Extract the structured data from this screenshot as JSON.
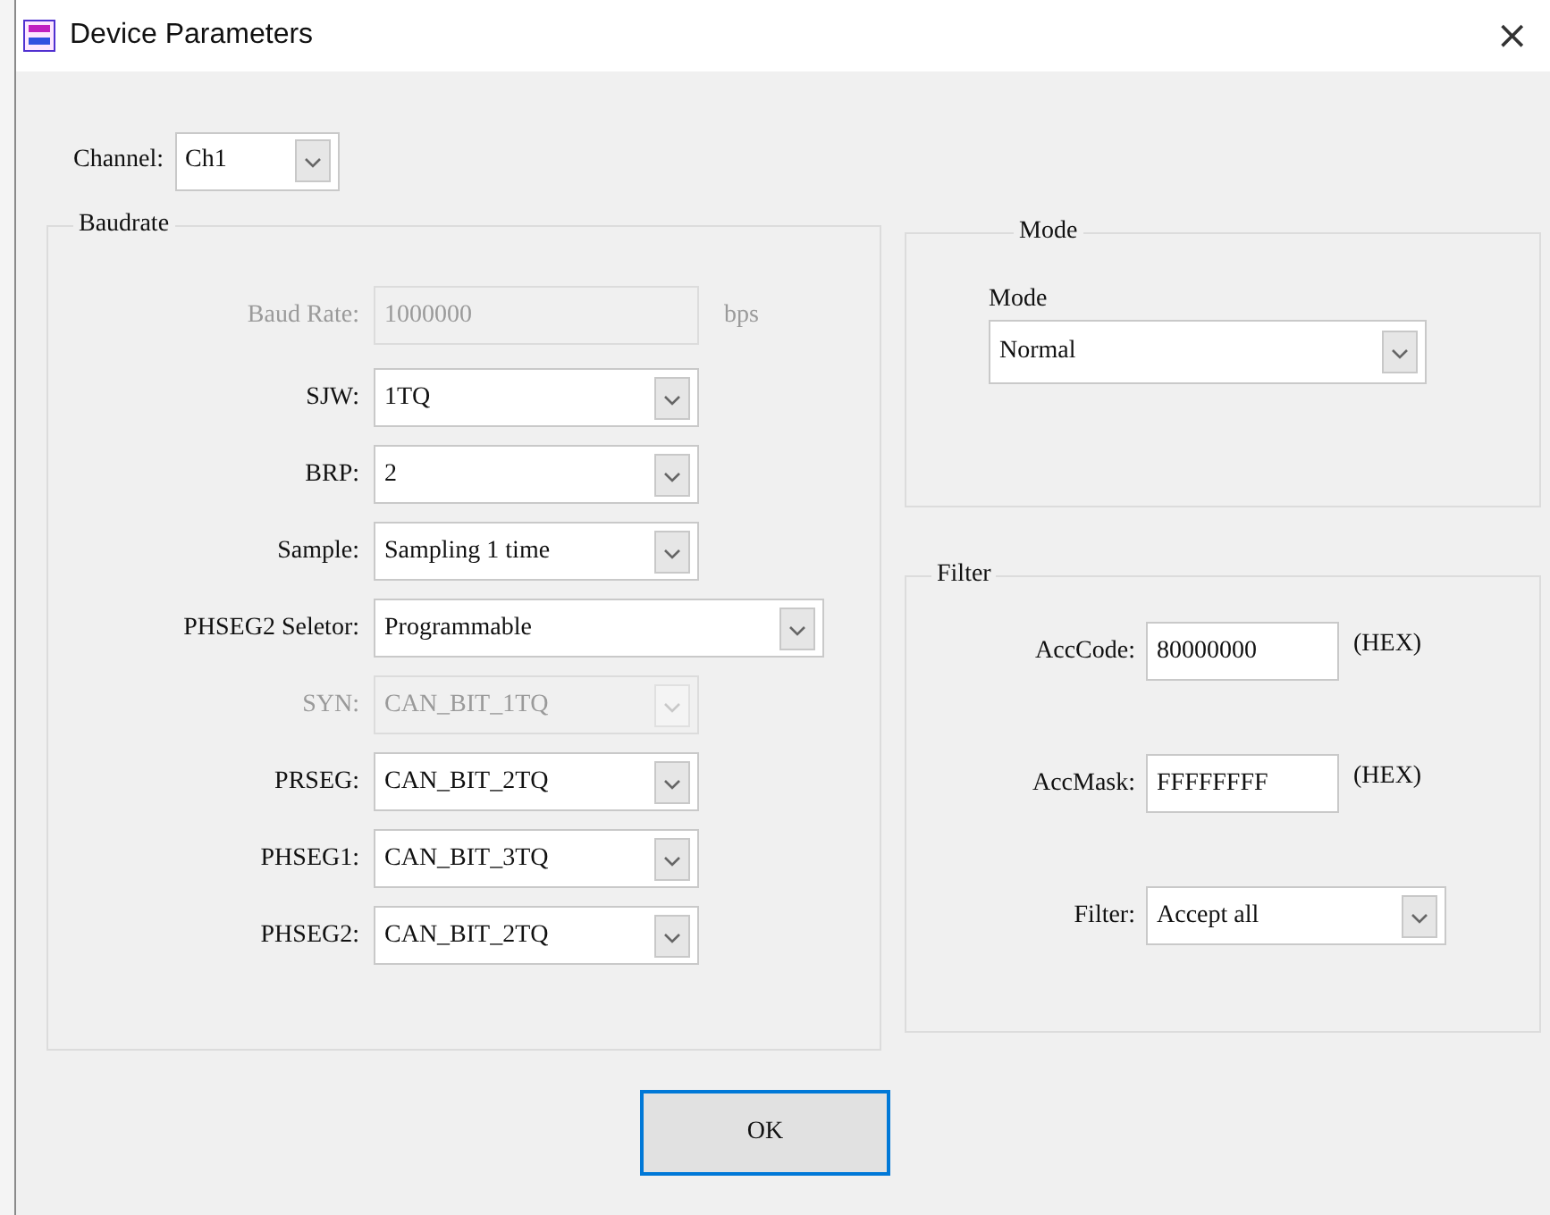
{
  "window": {
    "title": "Device Parameters",
    "close": "×"
  },
  "channel": {
    "label": "Channel:",
    "value": "Ch1"
  },
  "baudrate": {
    "title": "Baudrate",
    "rows": [
      {
        "kind": "input",
        "label": "Baud Rate:",
        "value": "1000000",
        "unit": "bps",
        "disabled": true
      },
      {
        "kind": "select",
        "label": "SJW:",
        "value": "1TQ",
        "disabled": false
      },
      {
        "kind": "select",
        "label": "BRP:",
        "value": "2",
        "disabled": false
      },
      {
        "kind": "select",
        "label": "Sample:",
        "value": "Sampling 1 time",
        "disabled": false
      },
      {
        "kind": "wide-select",
        "label": "PHSEG2 Seletor:",
        "value": "Programmable",
        "disabled": false
      },
      {
        "kind": "select",
        "label": "SYN:",
        "value": "CAN_BIT_1TQ",
        "disabled": true
      },
      {
        "kind": "select",
        "label": "PRSEG:",
        "value": "CAN_BIT_2TQ",
        "disabled": false
      },
      {
        "kind": "select",
        "label": "PHSEG1:",
        "value": "CAN_BIT_3TQ",
        "disabled": false
      },
      {
        "kind": "select",
        "label": "PHSEG2:",
        "value": "CAN_BIT_2TQ",
        "disabled": false
      }
    ]
  },
  "mode": {
    "title": "Mode",
    "label": "Mode",
    "value": "Normal"
  },
  "filter": {
    "title": "Filter",
    "rows": [
      {
        "kind": "input",
        "label": "AccCode:",
        "value": "80000000",
        "unit": "(HEX)"
      },
      {
        "kind": "input",
        "label": "AccMask:",
        "value": "FFFFFFFF",
        "unit": "(HEX)"
      },
      {
        "kind": "select",
        "label": "Filter:",
        "value": "Accept all"
      }
    ]
  },
  "buttons": [
    {
      "label": "OK",
      "focused": true
    }
  ]
}
